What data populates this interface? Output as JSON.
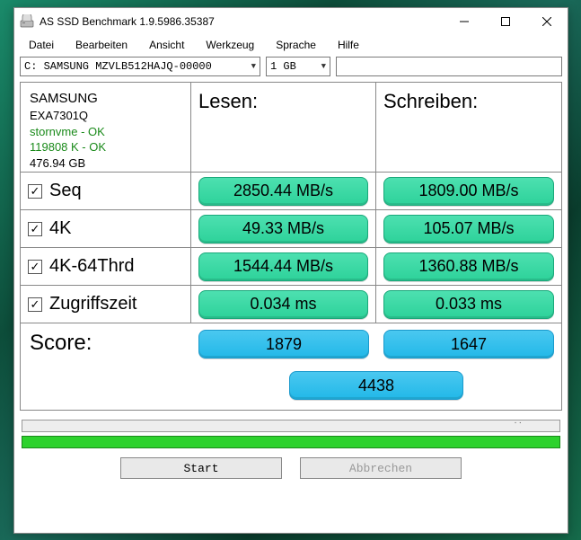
{
  "window": {
    "title": "AS SSD Benchmark 1.9.5986.35387"
  },
  "menu": {
    "file": "Datei",
    "edit": "Bearbeiten",
    "view": "Ansicht",
    "tools": "Werkzeug",
    "language": "Sprache",
    "help": "Hilfe"
  },
  "controls": {
    "drive_selected": "C: SAMSUNG MZVLB512HAJQ-00000",
    "size_selected": "1 GB",
    "text_value": ""
  },
  "info": {
    "drive_name": "SAMSUNG",
    "firmware": "EXA7301Q",
    "driver_status": "stornvme - OK",
    "iops_status": "119808 K - OK",
    "capacity": "476.94 GB"
  },
  "headers": {
    "read": "Lesen:",
    "write": "Schreiben:"
  },
  "tests": {
    "seq": {
      "label": "Seq",
      "checked": "✓",
      "read": "2850.44 MB/s",
      "write": "1809.00 MB/s"
    },
    "k4": {
      "label": "4K",
      "checked": "✓",
      "read": "49.33 MB/s",
      "write": "105.07 MB/s"
    },
    "k4_64": {
      "label": "4K-64Thrd",
      "checked": "✓",
      "read": "1544.44 MB/s",
      "write": "1360.88 MB/s"
    },
    "access": {
      "label": "Zugriffszeit",
      "checked": "✓",
      "read": "0.034 ms",
      "write": "0.033 ms"
    }
  },
  "score": {
    "label": "Score:",
    "read": "1879",
    "write": "1647",
    "total": "4438"
  },
  "buttons": {
    "start": "Start",
    "cancel": "Abbrechen"
  }
}
